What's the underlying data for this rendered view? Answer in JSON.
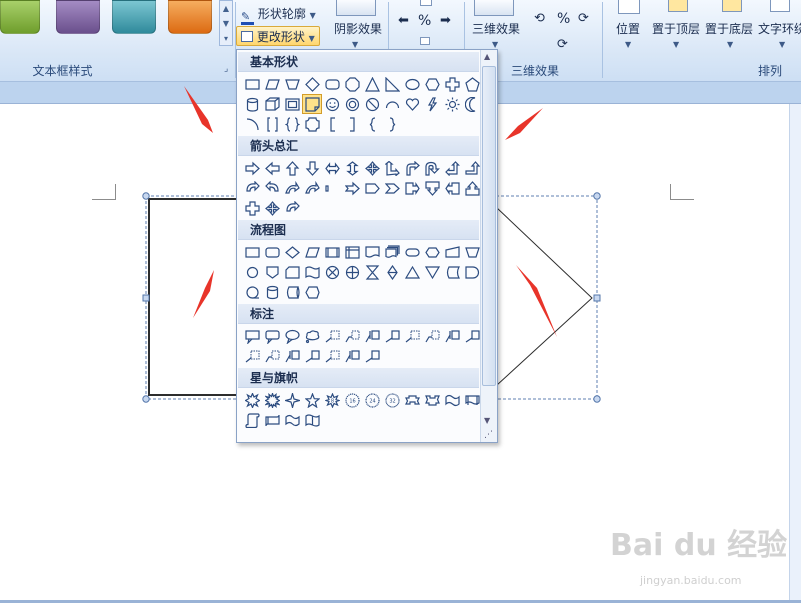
{
  "ribbon": {
    "groups": {
      "textbox_styles": "文本框样式",
      "shadow_effects_btn": "阴影效果",
      "three_d_effects_btn": "三维效果",
      "three_d_effects_group": "三维效果",
      "arrange": "排列"
    },
    "shape_outline": "形状轮廓",
    "change_shape": "更改形状",
    "position": "位置",
    "bring_to_front": "置于顶层",
    "send_to_back": "置于底层",
    "text_wrap": "文字环绕"
  },
  "dropdown": {
    "sections": {
      "basic": "基本形状",
      "arrows": "箭头总汇",
      "flowchart": "流程图",
      "callouts": "标注",
      "stars": "星与旗帜"
    }
  },
  "watermark": {
    "brand": "Bai du 经验",
    "url": "jingyan.baidu.com"
  },
  "colors": {
    "swatches": [
      "#7fae3a",
      "#7a5c9a",
      "#3d98a8",
      "#e0781e"
    ],
    "annotation_arrow": "#e8342a",
    "highlight": "#ffe28a"
  }
}
